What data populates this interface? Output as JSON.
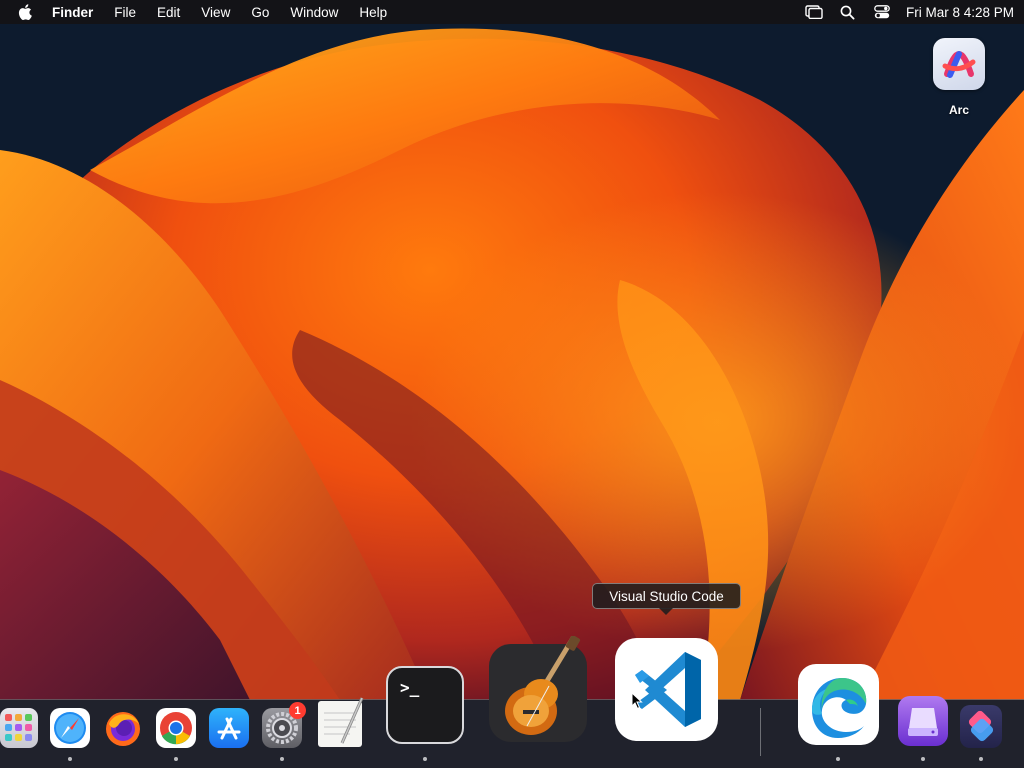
{
  "menubar": {
    "app_name": "Finder",
    "items": [
      "File",
      "Edit",
      "View",
      "Go",
      "Window",
      "Help"
    ],
    "clock": "Fri Mar 8  4:28 PM",
    "status_icons": [
      "screen-mirroring-icon",
      "spotlight-search-icon",
      "control-center-icon"
    ]
  },
  "desktop": {
    "icons": [
      {
        "label": "Arc",
        "icon": "arc-browser-icon"
      }
    ]
  },
  "tooltip": {
    "text": "Visual Studio Code"
  },
  "dock": {
    "items": [
      {
        "name": "Launchpad",
        "icon": "launchpad-icon",
        "running": false
      },
      {
        "name": "Safari",
        "icon": "safari-icon",
        "running": true
      },
      {
        "name": "Firefox",
        "icon": "firefox-icon",
        "running": false
      },
      {
        "name": "Google Chrome",
        "icon": "chrome-icon",
        "running": true
      },
      {
        "name": "App Store",
        "icon": "app-store-icon",
        "running": false
      },
      {
        "name": "System Settings",
        "icon": "system-settings-icon",
        "running": true,
        "badge": "1"
      },
      {
        "name": "TextEdit",
        "icon": "textedit-icon",
        "running": false
      },
      {
        "name": "Terminal",
        "icon": "terminal-icon",
        "running": true,
        "prompt": ">_"
      },
      {
        "name": "GarageBand",
        "icon": "garageband-icon",
        "running": false
      },
      {
        "name": "Visual Studio Code",
        "icon": "vscode-icon",
        "running": false,
        "hovered": true
      },
      {
        "name": "Microsoft Edge",
        "icon": "edge-icon",
        "running": true
      },
      {
        "name": "Storage app",
        "icon": "storage-icon",
        "running": true
      },
      {
        "name": "Shortcuts",
        "icon": "shortcuts-icon",
        "running": true
      }
    ]
  },
  "colors": {
    "accent_orange": "#ff7a10",
    "badge_red": "#ff3b30",
    "vscode_blue": "#1f8ad2",
    "wallpaper_dark": "#0d1b2e"
  }
}
